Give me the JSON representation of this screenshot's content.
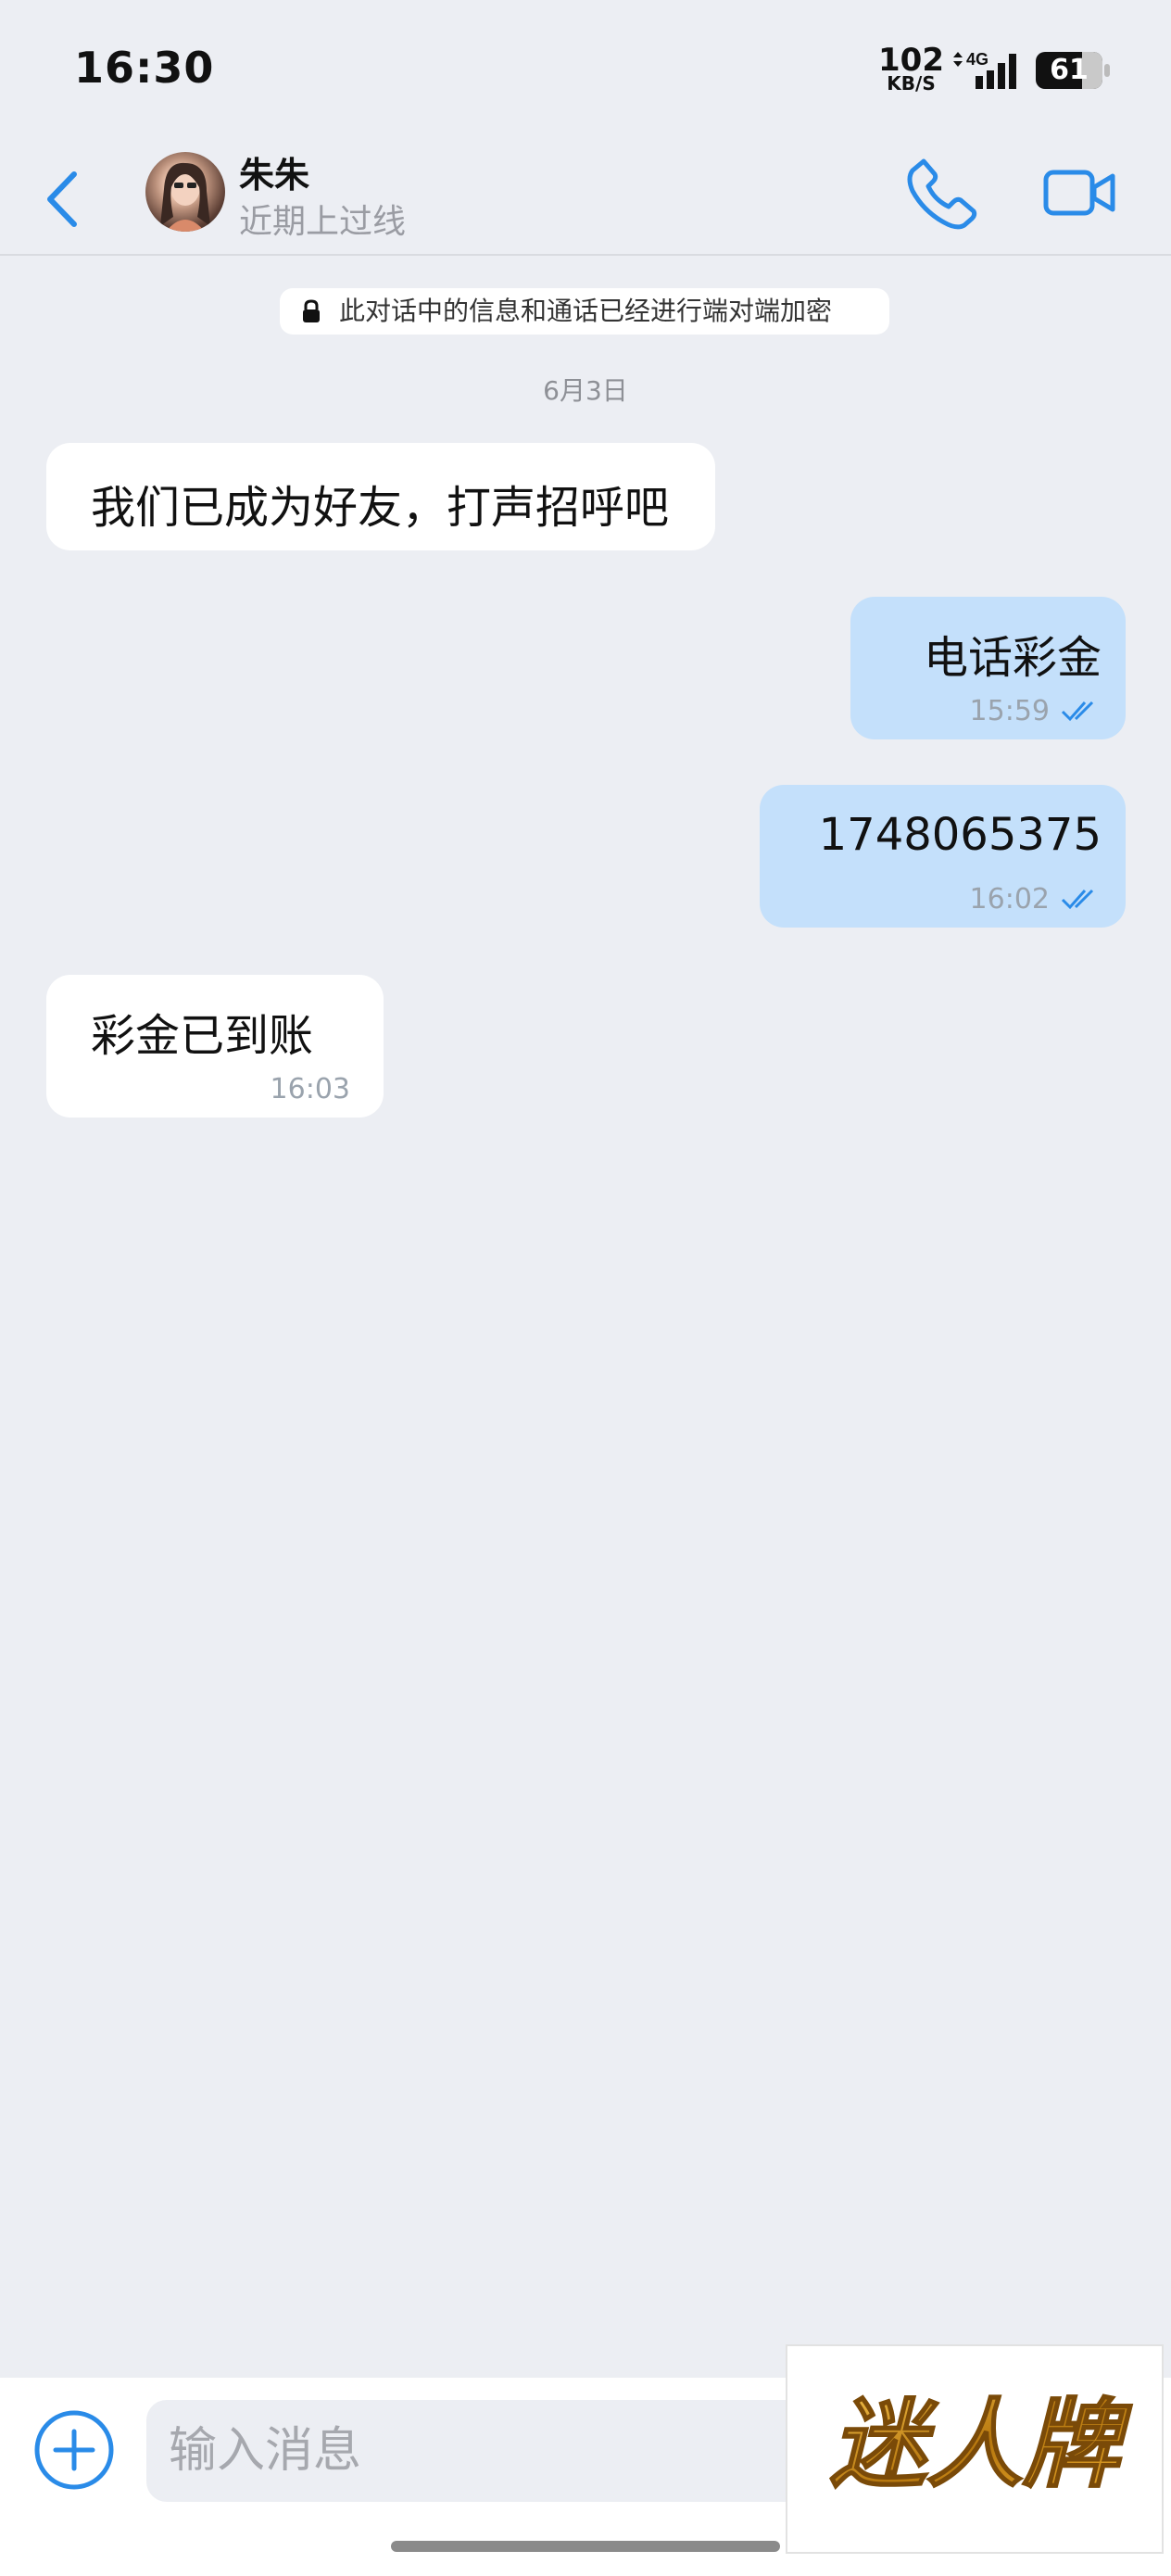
{
  "status_bar": {
    "time": "16:30",
    "net_speed_value": "102",
    "net_speed_unit": "KB/S",
    "network": "4G",
    "battery": "61"
  },
  "header": {
    "contact_name": "朱朱",
    "presence": "近期上过线",
    "icons": [
      "chevron-left-icon",
      "phone-icon",
      "video-camera-icon"
    ]
  },
  "chat": {
    "encryption_notice": "此对话中的信息和通话已经进行端对端加密",
    "date_label": "6月3日",
    "messages": [
      {
        "direction": "incoming",
        "text": "我们已成为好友，打声招呼吧",
        "time": ""
      },
      {
        "direction": "outgoing",
        "text": "电话彩金",
        "time": "15:59",
        "status": "read"
      },
      {
        "direction": "outgoing",
        "text": "1748065375",
        "time": "16:02",
        "status": "read"
      },
      {
        "direction": "incoming",
        "text": "彩金已到账",
        "time": "16:03"
      }
    ]
  },
  "composer": {
    "placeholder": "输入消息"
  },
  "watermark": {
    "text": "迷人牌"
  },
  "colors": {
    "accent": "#2a8be8",
    "background": "#eceef3",
    "outgoing_bubble": "#c4e0fb",
    "incoming_bubble": "#ffffff",
    "watermark_gold": "#c98a1a"
  }
}
